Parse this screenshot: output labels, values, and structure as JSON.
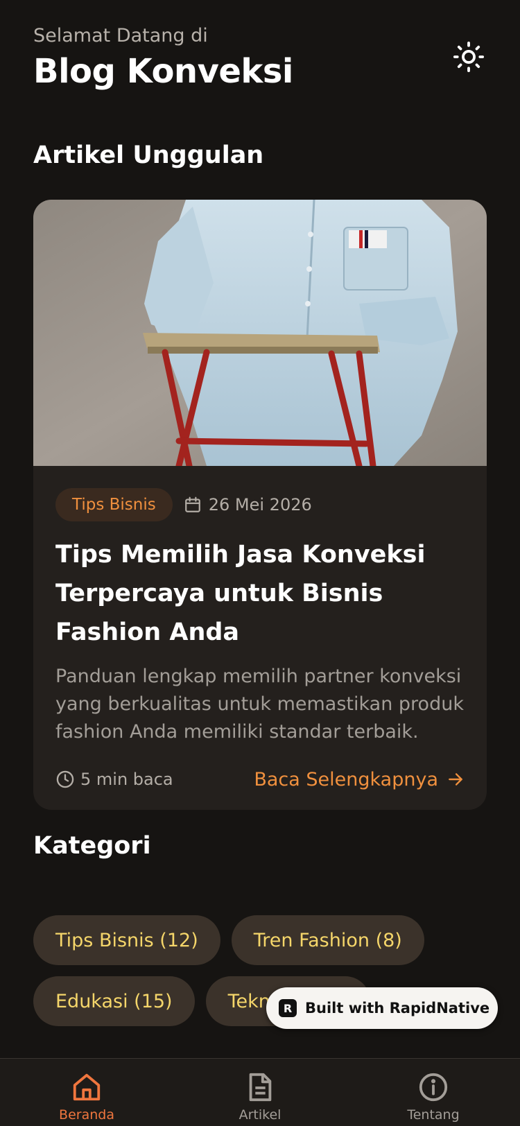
{
  "header": {
    "greeting": "Selamat Datang di",
    "app_name": "Blog Konveksi",
    "theme_icon": "sun-icon"
  },
  "featured": {
    "section_title": "Artikel Unggulan",
    "article": {
      "category": "Tips Bisnis",
      "date": "26 Mei 2026",
      "title": "Tips Memilih Jasa Konveksi Terpercaya untuk Bisnis Fashion Anda",
      "description": "Panduan lengkap memilih partner konveksi yang berkualitas untuk memastikan produk fashion Anda memiliki standar terbaik.",
      "read_time": "5 min baca",
      "read_more": "Baca Selengkapnya"
    }
  },
  "categories": {
    "section_title": "Kategori",
    "items": [
      {
        "label": "Tips Bisnis (12)"
      },
      {
        "label": "Tren Fashion (8)"
      },
      {
        "label": "Edukasi (15)"
      },
      {
        "label": "Teknologi (6)"
      }
    ]
  },
  "badge": {
    "label": "Built with RapidNative"
  },
  "tabbar": {
    "tabs": [
      {
        "label": "Beranda",
        "icon": "home-icon",
        "active": true
      },
      {
        "label": "Artikel",
        "icon": "document-icon",
        "active": false
      },
      {
        "label": "Tentang",
        "icon": "info-icon",
        "active": false
      }
    ]
  },
  "colors": {
    "background": "#161412",
    "card": "#24201d",
    "accent": "#f0903e",
    "chip_text": "#f5d66a"
  }
}
